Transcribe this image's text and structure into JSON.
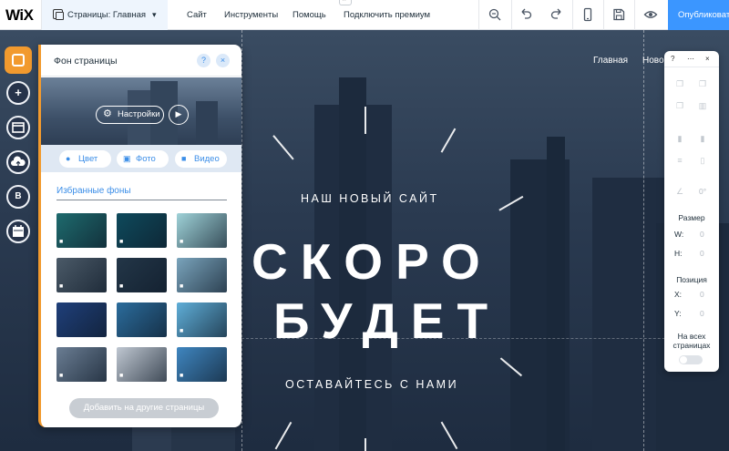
{
  "topbar": {
    "logo": "WiX",
    "pages_label": "Страницы: Главная",
    "menu": [
      "Сайт",
      "Инструменты",
      "Помощь",
      "Подключить премиум"
    ],
    "publish_label": "Опубликовать"
  },
  "site": {
    "nav": [
      "Главная",
      "Ново"
    ],
    "tagline_top": "НАШ НОВЫЙ САЙТ",
    "headline_1": "СКОРО",
    "headline_2": "БУДЕТ",
    "tagline_bottom": "ОСТАВАЙТЕСЬ С НАМИ"
  },
  "rail": {
    "items": [
      "background",
      "add",
      "store",
      "upload",
      "blog",
      "bookings"
    ],
    "blog_letter": "B"
  },
  "panel": {
    "title": "Фон страницы",
    "help": "?",
    "close": "×",
    "settings_label": "Настройки",
    "sources": [
      "Цвет",
      "Фото",
      "Видео"
    ],
    "favorites_title": "Избранные фоны",
    "add_button": "Добавить на другие страницы",
    "thumbnails": [
      {
        "color": "#1e6b6e",
        "video": true
      },
      {
        "color": "#0e4a5c",
        "video": true
      },
      {
        "color": "#9fd2d8",
        "video": true
      },
      {
        "color": "#4b5a68",
        "video": true
      },
      {
        "color": "#233648",
        "video": true
      },
      {
        "color": "#7aa4bc",
        "video": true
      },
      {
        "color": "#1f3f7a",
        "video": false
      },
      {
        "color": "#2b6c9c",
        "video": false
      },
      {
        "color": "#5faed8",
        "video": true
      },
      {
        "color": "#6a7d93",
        "video": true
      },
      {
        "color": "#bfc7d1",
        "video": true
      },
      {
        "color": "#3f86c0",
        "video": true
      }
    ]
  },
  "inspector": {
    "help": "?",
    "close": "×",
    "angle_value": "0°",
    "size_label": "Размер",
    "w_label": "W:",
    "w_value": "0",
    "h_label": "H:",
    "h_value": "0",
    "position_label": "Позиция",
    "x_label": "X:",
    "x_value": "0",
    "y_label": "Y:",
    "y_value": "0",
    "all_pages_label_1": "На всех",
    "all_pages_label_2": "страницах"
  }
}
